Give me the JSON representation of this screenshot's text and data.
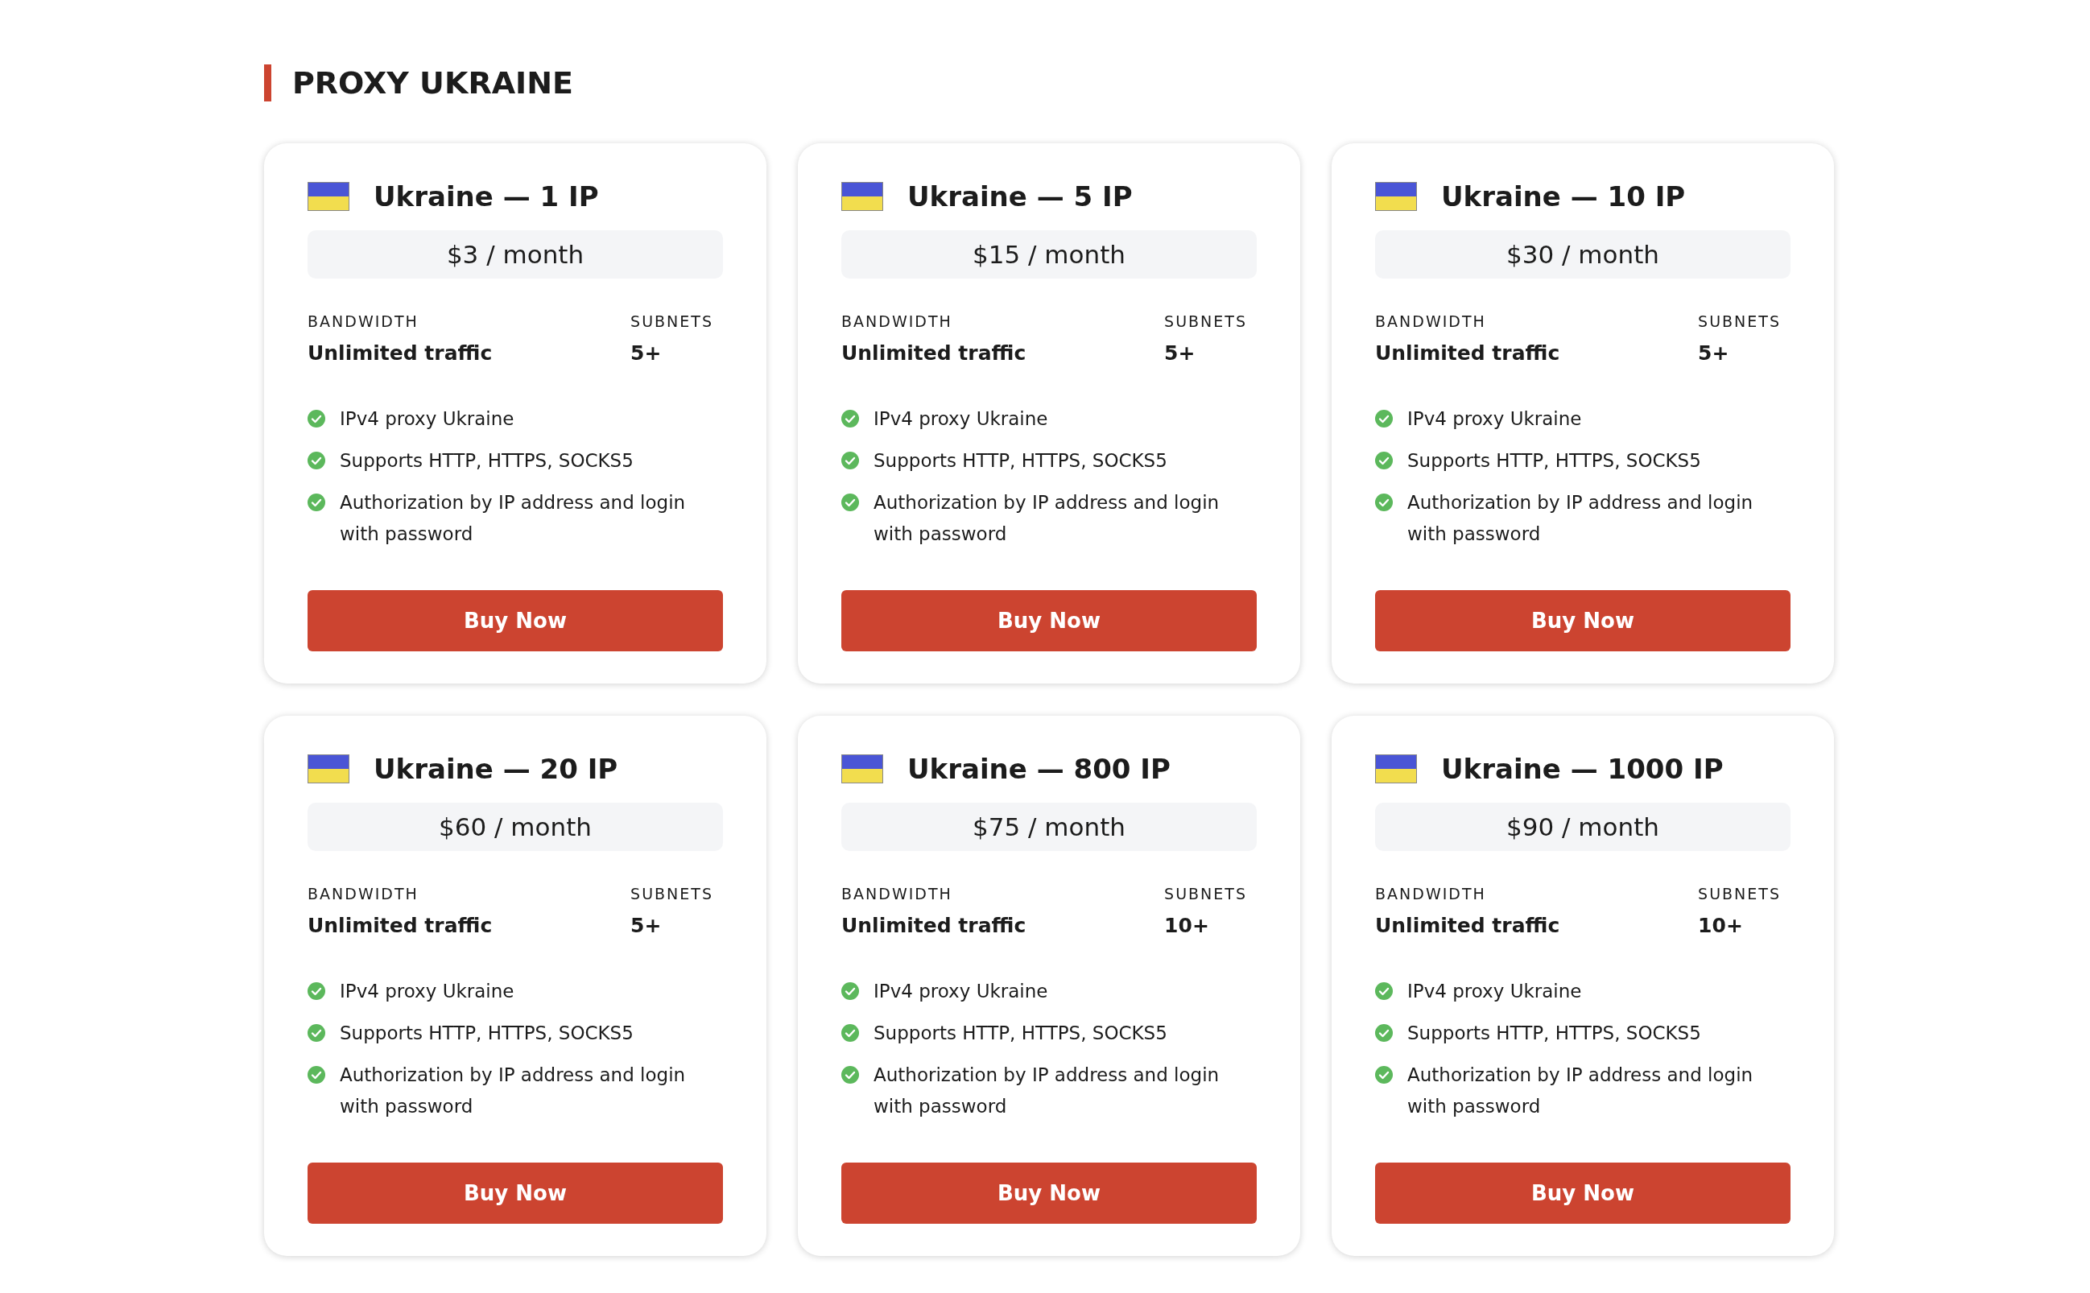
{
  "heading": "PROXY UKRAINE",
  "plans": [
    {
      "title": "Ukraine — 1 IP",
      "price": "$3 / month",
      "bandwidth_label": "BANDWIDTH",
      "bandwidth": "Unlimited traffic",
      "subnets_label": "SUBNETS",
      "subnets": "5+",
      "features": [
        "IPv4 proxy Ukraine",
        "Supports HTTP, HTTPS, SOCKS5",
        "Authorization by IP address and login with password"
      ],
      "button": "Buy Now"
    },
    {
      "title": "Ukraine — 5 IP",
      "price": "$15 / month",
      "bandwidth_label": "BANDWIDTH",
      "bandwidth": "Unlimited traffic",
      "subnets_label": "SUBNETS",
      "subnets": "5+",
      "features": [
        "IPv4 proxy Ukraine",
        "Supports HTTP, HTTPS, SOCKS5",
        "Authorization by IP address and login with password"
      ],
      "button": "Buy Now"
    },
    {
      "title": "Ukraine — 10 IP",
      "price": "$30 / month",
      "bandwidth_label": "BANDWIDTH",
      "bandwidth": "Unlimited traffic",
      "subnets_label": "SUBNETS",
      "subnets": "5+",
      "features": [
        "IPv4 proxy Ukraine",
        "Supports HTTP, HTTPS, SOCKS5",
        "Authorization by IP address and login with password"
      ],
      "button": "Buy Now"
    },
    {
      "title": "Ukraine — 20 IP",
      "price": "$60 / month",
      "bandwidth_label": "BANDWIDTH",
      "bandwidth": "Unlimited traffic",
      "subnets_label": "SUBNETS",
      "subnets": "5+",
      "features": [
        "IPv4 proxy Ukraine",
        "Supports HTTP, HTTPS, SOCKS5",
        "Authorization by IP address and login with password"
      ],
      "button": "Buy Now"
    },
    {
      "title": "Ukraine — 800 IP",
      "price": "$75 / month",
      "bandwidth_label": "BANDWIDTH",
      "bandwidth": "Unlimited traffic",
      "subnets_label": "SUBNETS",
      "subnets": "10+",
      "features": [
        "IPv4 proxy Ukraine",
        "Supports HTTP, HTTPS, SOCKS5",
        "Authorization by IP address and login with password"
      ],
      "button": "Buy Now"
    },
    {
      "title": "Ukraine — 1000 IP",
      "price": "$90 / month",
      "bandwidth_label": "BANDWIDTH",
      "bandwidth": "Unlimited traffic",
      "subnets_label": "SUBNETS",
      "subnets": "10+",
      "features": [
        "IPv4 proxy Ukraine",
        "Supports HTTP, HTTPS, SOCKS5",
        "Authorization by IP address and login with password"
      ],
      "button": "Buy Now"
    }
  ]
}
